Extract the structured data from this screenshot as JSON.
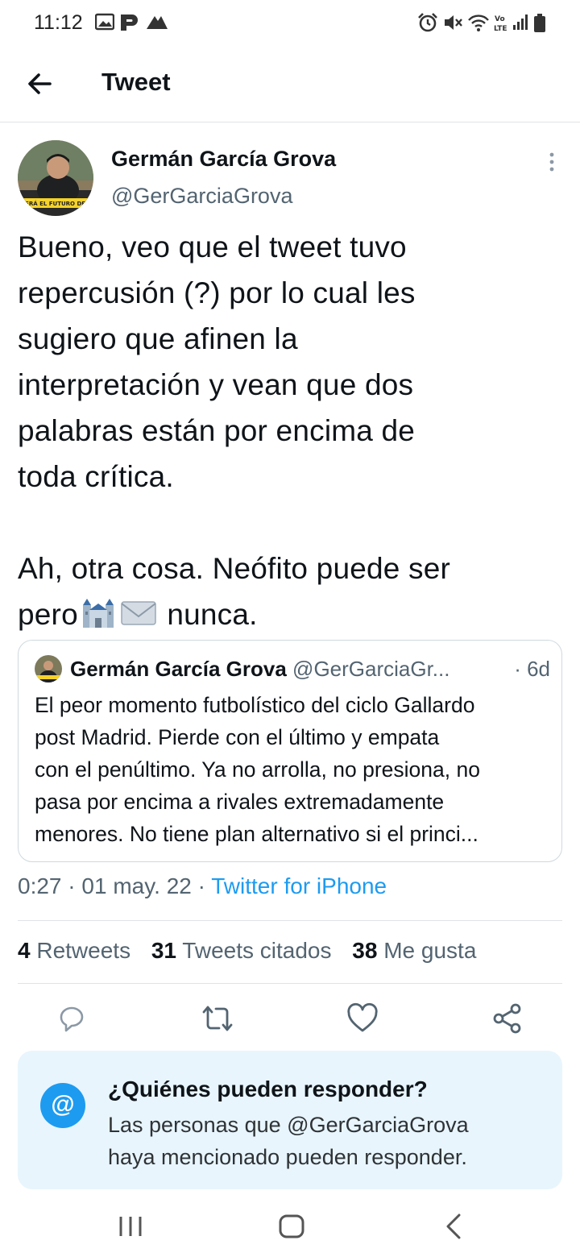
{
  "status_bar": {
    "time": "11:12",
    "icons_left": [
      "gallery-icon",
      "p-app-icon",
      "signal-arrows-icon"
    ],
    "icons_right": [
      "alarm-icon",
      "mute-icon",
      "wifi-icon",
      "volte-icon",
      "cell-signal-icon",
      "battery-icon"
    ]
  },
  "appbar": {
    "title": "Tweet"
  },
  "tweet": {
    "author_name": "Germán García Grova",
    "author_handle": "@GerGarciaGrova",
    "avatar_caption": "SERÁ EL FUTURO DE DAV",
    "lines": [
      "Bueno, veo que el tweet tuvo",
      "repercusión (?) por lo cual les",
      "sugiero que afinen la",
      "interpretación y vean que dos",
      "palabras están por encima de",
      "toda crítica.",
      "",
      "Ah, otra cosa. Neófito puede ser"
    ],
    "last_line_start": "pero",
    "last_line_end": "nunca.",
    "emoji_names": [
      "castle-emoji",
      "envelope-emoji"
    ]
  },
  "quote": {
    "author_name": "Germán García Grova",
    "author_handle": "@GerGarciaGr...",
    "time": "· 6d",
    "lines": [
      "El peor momento futbolístico del ciclo Gallardo",
      "post Madrid. Pierde con el último y empata",
      "con el penúltimo. Ya no arrolla, no presiona, no",
      "pasa por encima a rivales extremadamente",
      "menores. No tiene plan alternativo si el princi..."
    ]
  },
  "meta": {
    "time": "0:27",
    "sep": "·",
    "date": "01 may. 22",
    "sep2": "·",
    "source": "Twitter for iPhone"
  },
  "stats": [
    {
      "count": "4",
      "label": "Retweets"
    },
    {
      "count": "31",
      "label": "Tweets citados"
    },
    {
      "count": "38",
      "label": "Me gusta"
    }
  ],
  "actions": [
    "reply-icon",
    "retweet-icon",
    "like-icon",
    "share-icon"
  ],
  "reply_card": {
    "icon": "@",
    "title": "¿Quiénes pueden responder?",
    "body_line1": "Las personas que @GerGarciaGrova",
    "body_line2": "haya mencionado pueden responder."
  },
  "colors": {
    "accent": "#1d9bf0",
    "text": "#0f1419",
    "secondary": "#536471",
    "reply_card_bg": "#e8f5fd"
  }
}
